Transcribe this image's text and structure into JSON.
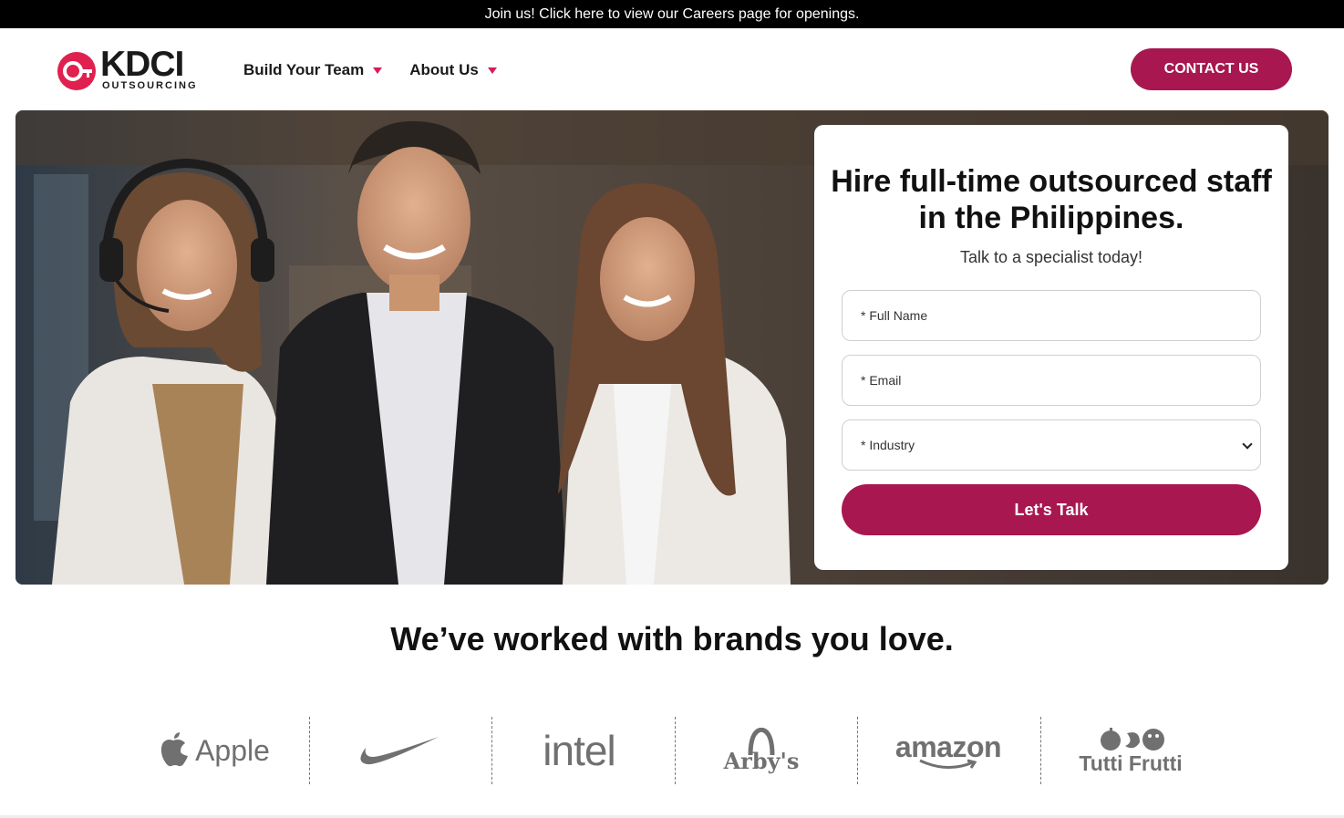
{
  "announcement": "Join us! Click here to view our Careers page for openings.",
  "logo": {
    "main": "KDCI",
    "sub": "OUTSOURCING",
    "accent": "#e0204f"
  },
  "nav": [
    {
      "label": "Build Your Team"
    },
    {
      "label": "About Us"
    }
  ],
  "contact_button": "CONTACT US",
  "form": {
    "title": "Hire full-time outsourced staff in the Philippines.",
    "subtitle": "Talk to a specialist today!",
    "full_name_placeholder": "* Full Name",
    "email_placeholder": "* Email",
    "industry_placeholder": "* Industry",
    "submit_label": "Let's Talk"
  },
  "brands": {
    "title": "We’ve worked with brands you love.",
    "items": [
      {
        "name": "Apple",
        "icon": "apple-logo"
      },
      {
        "name": "Nike",
        "icon": "nike-swoosh"
      },
      {
        "name": "intel",
        "icon": "intel-logo"
      },
      {
        "name": "Arby's",
        "icon": "arbys-logo"
      },
      {
        "name": "amazon",
        "icon": "amazon-logo"
      },
      {
        "name": "Tutti Frutti",
        "icon": "tutti-frutti-logo"
      }
    ]
  },
  "colors": {
    "brand": "#a8174f",
    "accent": "#e0204f",
    "topbar": "#000000",
    "logo_gray": "#707070"
  }
}
